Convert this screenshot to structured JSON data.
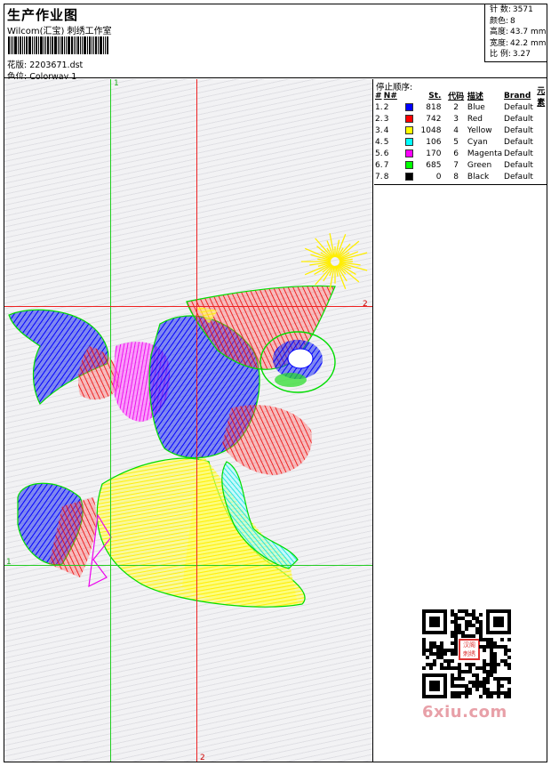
{
  "header": {
    "title": "生产作业图",
    "company": "Wilcom(汇宝) 刺绣工作室",
    "design_label": "花版:",
    "design_value": "2203671.dst",
    "colorway_label": "色位:",
    "colorway_value": "Colorway 1"
  },
  "stats": {
    "stitches_label": "针 数:",
    "stitches_value": "3571",
    "colors_label": "颜色:",
    "colors_value": "8",
    "height_label": "高度:",
    "height_value": "43.7 mm",
    "width_label": "宽度:",
    "width_value": "42.2 mm",
    "ratio_label": "比 例:",
    "ratio_value": "3.27"
  },
  "stop_sequence": {
    "title": "停止顺序:",
    "headers": {
      "n": "#",
      "no": "N#",
      "st": "St.",
      "code": "代码",
      "desc": "描述",
      "brand": "Brand",
      "elem": "元素"
    },
    "rows": [
      {
        "n": "1.",
        "no": "2",
        "color": "#0000ff",
        "st": "818",
        "code": "2",
        "desc": "Blue",
        "brand": "Default"
      },
      {
        "n": "2.",
        "no": "3",
        "color": "#ff0000",
        "st": "742",
        "code": "3",
        "desc": "Red",
        "brand": "Default"
      },
      {
        "n": "3.",
        "no": "4",
        "color": "#ffff00",
        "st": "1048",
        "code": "4",
        "desc": "Yellow",
        "brand": "Default"
      },
      {
        "n": "4.",
        "no": "5",
        "color": "#00ffff",
        "st": "106",
        "code": "5",
        "desc": "Cyan",
        "brand": "Default"
      },
      {
        "n": "5.",
        "no": "6",
        "color": "#ff00ff",
        "st": "170",
        "code": "6",
        "desc": "Magenta",
        "brand": "Default"
      },
      {
        "n": "6.",
        "no": "7",
        "color": "#00ff00",
        "st": "685",
        "code": "7",
        "desc": "Green",
        "brand": "Default"
      },
      {
        "n": "7.",
        "no": "8",
        "color": "#000000",
        "st": "0",
        "code": "8",
        "desc": "Black",
        "brand": "Default"
      }
    ]
  },
  "guides": {
    "v1": "1",
    "h1": "1",
    "h2": "2",
    "v2": "2"
  },
  "qr": {
    "stamp_text": "汉阁刺绣"
  },
  "watermark": "6xiu.com"
}
